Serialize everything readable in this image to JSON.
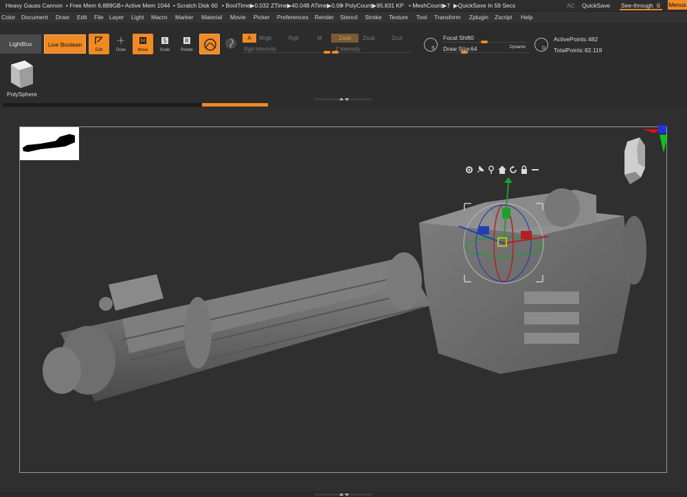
{
  "titlebar": {
    "items": [
      "Heavy Gauss Cannon",
      "• Free Mem 6.889GB",
      "• Active Mem 1044",
      "• Scratch Disk 60",
      "• BoolTime▶0.032 ZTime▶40.048 ATime▶0.08",
      "• PolyCount▶95.831 KP",
      "• MeshCount▶7",
      "▶QuickSave In 59 Secs"
    ],
    "ac": "AC",
    "quicksave": "QuickSave",
    "see_through_label": "See-through",
    "see_through_value": "0",
    "menus": "Menus"
  },
  "menubar": [
    "Color",
    "Document",
    "Draw",
    "Edit",
    "File",
    "Layer",
    "Light",
    "Macro",
    "Marker",
    "Material",
    "Movie",
    "Picker",
    "Preferences",
    "Render",
    "Stencil",
    "Stroke",
    "Texture",
    "Tool",
    "Transform",
    "Zplugin",
    "Zscript",
    "Help"
  ],
  "shelf": {
    "lightbox": "LightBox",
    "live_boolean": "Live Boolean",
    "tools": [
      {
        "label": "Edit",
        "icon": "edit-icon",
        "on": true
      },
      {
        "label": "Draw",
        "icon": "draw-icon",
        "on": false
      },
      {
        "label": "Move",
        "icon": "move-icon",
        "on": true
      },
      {
        "label": "Scale",
        "icon": "scale-icon",
        "on": false
      },
      {
        "label": "Rotate",
        "icon": "rotate-icon",
        "on": false
      },
      {
        "label": "",
        "icon": "sphere-material-icon",
        "on": true
      }
    ],
    "channels": {
      "a": "A",
      "mrgb": "Mrgb",
      "rgb": "Rgb",
      "m": "M",
      "zadd": "Zadd",
      "zsub": "Zsub",
      "zcut": "Zcut"
    },
    "rgb_intensity": "Rgb Intensity",
    "z_intensity": "Z Intensity",
    "focal_shift_label": "Focal Shift",
    "focal_shift_value": "0",
    "draw_size_label": "Draw Size",
    "draw_size_value": "64",
    "dynamic": "Dynamic",
    "active_points_label": "ActivePoints:",
    "active_points_value": "482",
    "total_points_label": "TotalPoints:",
    "total_points_value": "82.119",
    "polysphere": "PolySphere"
  },
  "colors": {
    "accent": "#f08a24",
    "bg": "#2b2b2b",
    "canvas": "#2f2f2f"
  }
}
